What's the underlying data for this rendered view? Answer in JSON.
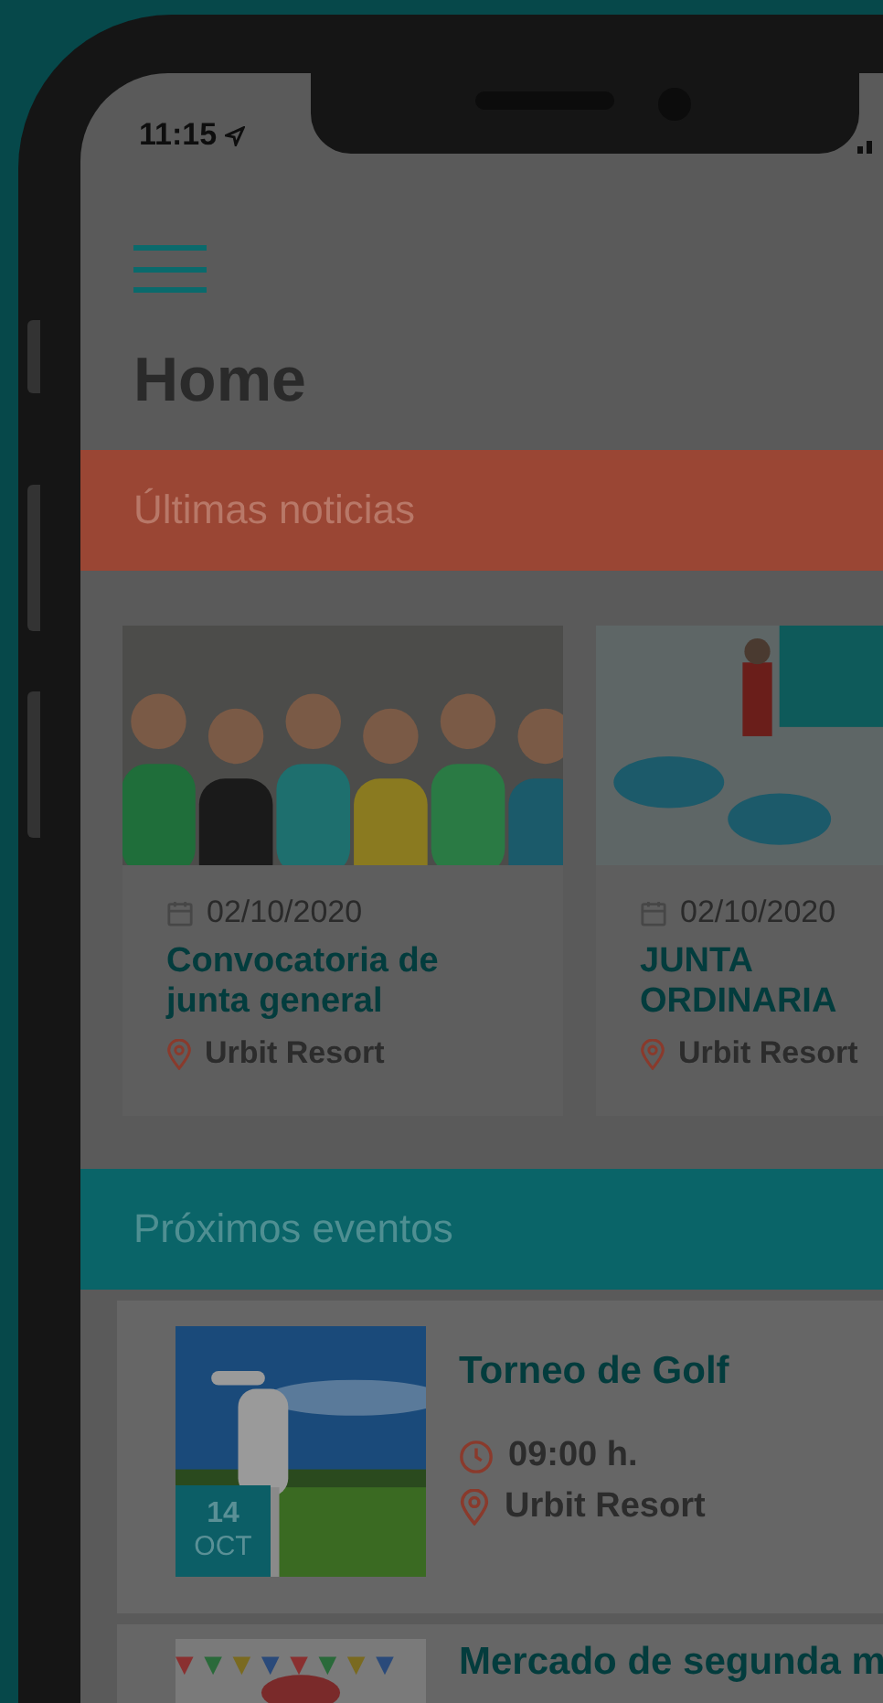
{
  "status_bar": {
    "time": "11:15"
  },
  "page_title": "Home",
  "news": {
    "title": "Últimas noticias",
    "items": [
      {
        "date": "02/10/2020",
        "title": "Convocatoria de junta general",
        "location": "Urbit Resort"
      },
      {
        "date": "02/10/2020",
        "title": "JUNTA ORDINARIA",
        "location": "Urbit Resort"
      }
    ]
  },
  "events": {
    "title": "Próximos eventos",
    "items": [
      {
        "day": "14",
        "month": "OCT",
        "title": "Torneo de Golf",
        "time": "09:00 h.",
        "location": "Urbit Resort"
      },
      {
        "title": "Mercado de segunda m"
      }
    ]
  }
}
